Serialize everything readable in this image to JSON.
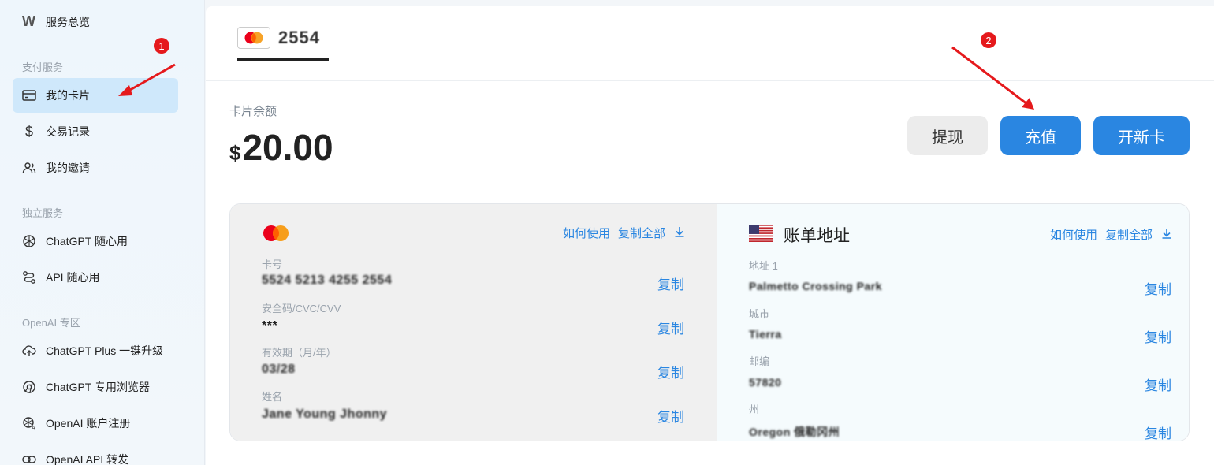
{
  "sidebar": {
    "brand": {
      "logo": "W",
      "label": "服务总览"
    },
    "sections": [
      {
        "title": "支付服务"
      },
      {
        "title": "独立服务"
      },
      {
        "title": "OpenAI 专区"
      }
    ],
    "items": [
      {
        "label": "我的卡片",
        "icon": "card-icon"
      },
      {
        "label": "交易记录",
        "icon": "dollar-icon"
      },
      {
        "label": "我的邀请",
        "icon": "users-icon"
      },
      {
        "label": "ChatGPT 随心用",
        "icon": "openai-icon"
      },
      {
        "label": "API 随心用",
        "icon": "api-icon"
      },
      {
        "label": "ChatGPT Plus 一键升级",
        "icon": "upload-cloud-icon"
      },
      {
        "label": "ChatGPT 专用浏览器",
        "icon": "browser-icon"
      },
      {
        "label": "OpenAI 账户注册",
        "icon": "openai-account-icon"
      },
      {
        "label": "OpenAI API 转发",
        "icon": "link-icon"
      }
    ]
  },
  "tabs": {
    "card_label": "2554"
  },
  "balance": {
    "label": "卡片余额",
    "currency": "$",
    "amount": "20.00"
  },
  "actions": {
    "withdraw": "提现",
    "recharge": "充值",
    "new_card": "开新卡"
  },
  "card_info": {
    "how_to_use": "如何使用",
    "copy_all": "复制全部",
    "copy": "复制",
    "fields": [
      {
        "label": "卡号",
        "value": "5524 5213 4255 2554"
      },
      {
        "label": "安全码/CVC/CVV",
        "value": "***"
      },
      {
        "label": "有效期（月/年）",
        "value": "03/28"
      },
      {
        "label": "姓名",
        "value": "Jane Young Jhonny"
      }
    ]
  },
  "billing": {
    "title": "账单地址",
    "how_to_use": "如何使用",
    "copy_all": "复制全部",
    "copy": "复制",
    "fields": [
      {
        "label": "地址 1",
        "value": "Palmetto Crossing Park"
      },
      {
        "label": "城市",
        "value": "Tierra"
      },
      {
        "label": "邮编",
        "value": "57820"
      },
      {
        "label": "州",
        "value": "Oregon 俄勒冈州"
      }
    ]
  },
  "annotations": {
    "step1": "1",
    "step2": "2"
  },
  "colors": {
    "accent": "#2a86e1",
    "active_bg": "#cfe8fb",
    "annotation": "#e5191c"
  }
}
